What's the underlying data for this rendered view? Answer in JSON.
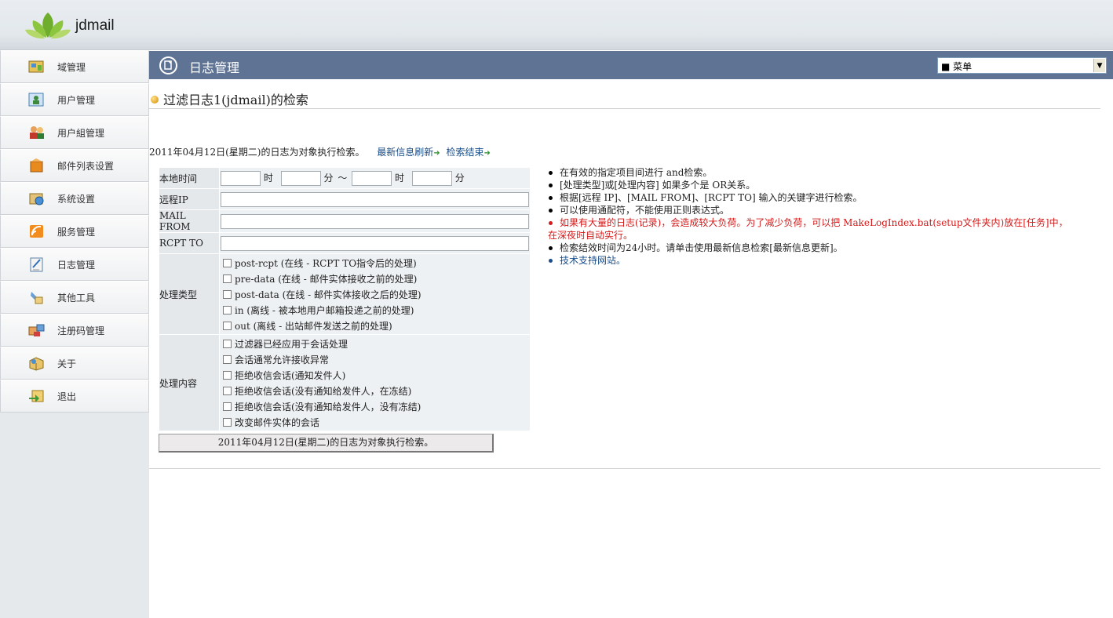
{
  "app": {
    "logo_text": "jdmail"
  },
  "sidebar": {
    "items": [
      {
        "label": "域管理",
        "icon": "domain-icon"
      },
      {
        "label": "用户管理",
        "icon": "user-icon"
      },
      {
        "label": "用户組管理",
        "icon": "user-group-icon"
      },
      {
        "label": "邮件列表设置",
        "icon": "mail-list-icon"
      },
      {
        "label": "系统设置",
        "icon": "system-settings-icon"
      },
      {
        "label": "服务管理",
        "icon": "service-icon"
      },
      {
        "label": "日志管理",
        "icon": "log-icon"
      },
      {
        "label": "其他工具",
        "icon": "tools-icon"
      },
      {
        "label": "注册码管理",
        "icon": "license-icon"
      },
      {
        "label": "关于",
        "icon": "about-icon"
      },
      {
        "label": "退出",
        "icon": "logout-icon"
      }
    ]
  },
  "titlebar": {
    "title": "日志管理",
    "menu_selected": "■ 菜单"
  },
  "section": {
    "title": "过滤日志1(jdmail)的检索"
  },
  "intro": {
    "text": "2011年04月12日(星期二)的日志为对象执行检索。",
    "refresh_link": "最新信息刷新",
    "end_link": "检索结束"
  },
  "form": {
    "time": {
      "label": "本地时间",
      "hour": "时",
      "minute": "分",
      "tilde": "～"
    },
    "remote_ip": {
      "label": "远程IP",
      "value": ""
    },
    "mail_from": {
      "label": "MAIL FROM",
      "value": ""
    },
    "rcpt_to": {
      "label": "RCPT TO",
      "value": ""
    },
    "process_type": {
      "label": "处理类型",
      "options": [
        "post-rcpt (在线 - RCPT TO指令后的处理)",
        "pre-data (在线 - 邮件实体接收之前的处理)",
        "post-data (在线 - 邮件实体接收之后的处理)",
        "in (离线 - 被本地用户邮箱投递之前的处理)",
        "out (离线 - 出站邮件发送之前的处理)"
      ]
    },
    "process_content": {
      "label": "处理内容",
      "options": [
        "过滤器已经应用于会话处理",
        "会话通常允许接收异常",
        "拒绝收信会话(通知发件人)",
        "拒绝收信会话(没有通知给发件人，在冻结)",
        "拒绝收信会话(没有通知给发件人，没有冻结)",
        "改变邮件实体的会话"
      ]
    },
    "submit_label": "2011年04月12日(星期二)的日志为对象执行检索。"
  },
  "notes": [
    "在有效的指定项目间进行 and检索。",
    "[处理类型]或[处理内容] 如果多个是 OR关系。",
    "根据[远程 IP]、[MAIL FROM]、[RCPT TO] 输入的关键字进行检索。",
    "可以使用通配符，不能使用正则表达式。",
    "如果有大量的日志(记录)，会造成较大负荷。为了减少负荷，可以把 MakeLogIndex.bat(setup文件夹内)放在[任务]中，",
    "在深夜时自动实行。",
    "检索结效时间为24小时。请单击使用最新信息检索[最新信息更新]。",
    "技术支持网站。"
  ],
  "colors": {
    "titlebar": "#5f7494",
    "warning": "#d41a1a",
    "link": "#1a4e8a"
  }
}
